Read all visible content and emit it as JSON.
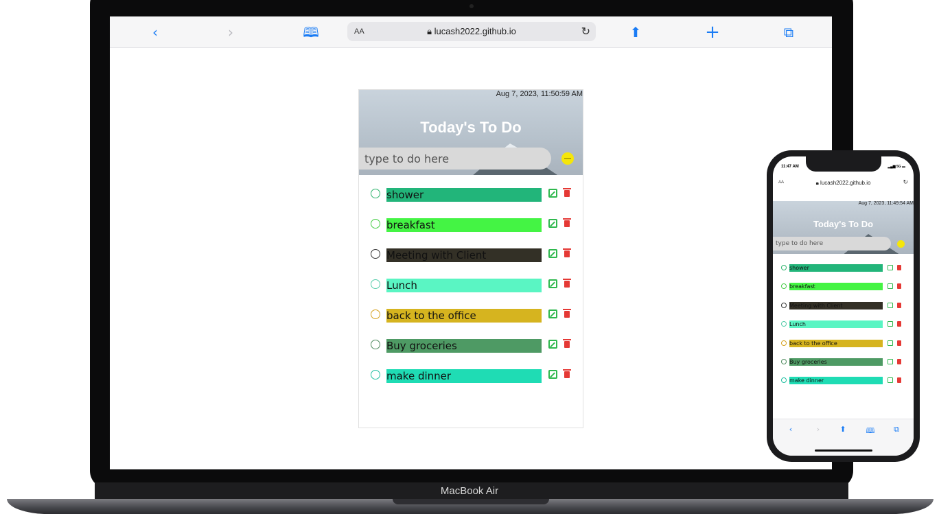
{
  "desktop": {
    "browser": {
      "address_prefix": "AA",
      "domain": "lucash2022.github.io",
      "icons": [
        "back-icon",
        "forward-icon",
        "bookmarks-icon",
        "lock-icon",
        "reload-icon",
        "share-icon",
        "new-tab-icon",
        "tabs-icon"
      ]
    },
    "app": {
      "datetime": "Aug 7, 2023, 11:50:59 AM",
      "title": "Today's To Do",
      "input_placeholder": "type to do here",
      "tasks": [
        {
          "text": "shower",
          "color": "#22b57a",
          "radio": "#2db36c"
        },
        {
          "text": "breakfast",
          "color": "#44f444",
          "radio": "#44cc44"
        },
        {
          "text": "Meeting with Client",
          "color": "#333026",
          "radio": "#333333"
        },
        {
          "text": "Lunch",
          "color": "#5af5c3",
          "radio": "#55ccaa"
        },
        {
          "text": "back to the office",
          "color": "#d6b41f",
          "radio": "#d6a21f"
        },
        {
          "text": "Buy groceries",
          "color": "#4e9a64",
          "radio": "#4e8a5e"
        },
        {
          "text": "make dinner",
          "color": "#1fdcb4",
          "radio": "#1fbfa0"
        }
      ]
    },
    "device_label": "MacBook Air"
  },
  "phone": {
    "status_time": "11:47 AM",
    "status_right": "5G",
    "address_prefix": "AA",
    "domain": "lucash2022.github.io",
    "datetime": "Aug 7, 2023, 11:49:54 AM",
    "title": "Today's To Do",
    "input_placeholder": "type to do here"
  }
}
